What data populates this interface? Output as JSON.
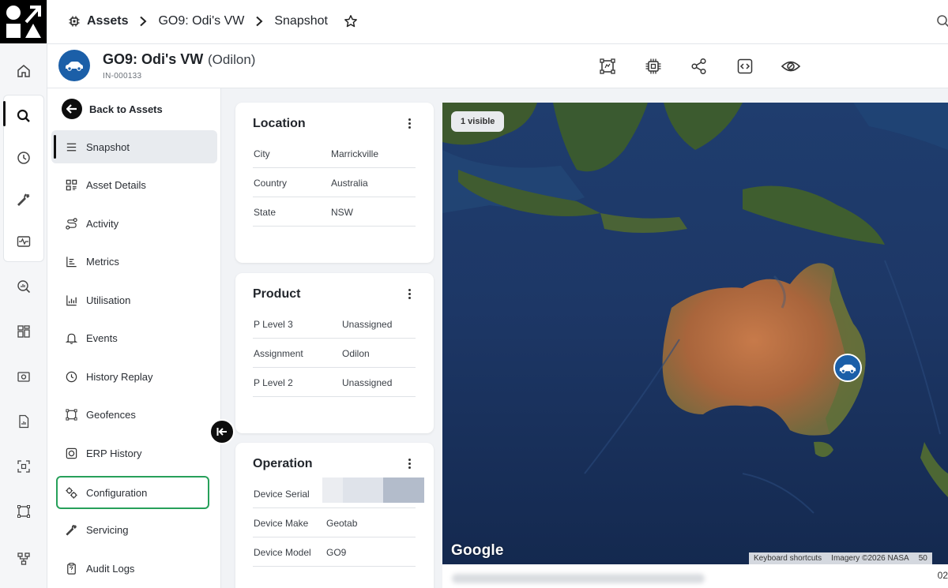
{
  "breadcrumb": {
    "root": "Assets",
    "asset": "GO9: Odi's VW",
    "current": "Snapshot"
  },
  "asset": {
    "name": "GO9: Odi's VW",
    "owner": "(Odilon)",
    "id": "IN-000133"
  },
  "header_actions": [
    "geofence-icon",
    "device-chip-icon",
    "share-icon",
    "embed-code-icon",
    "visibility-icon"
  ],
  "subnav": {
    "back_label": "Back to Assets",
    "items": [
      {
        "label": "Snapshot",
        "icon": "list-icon"
      },
      {
        "label": "Asset Details",
        "icon": "details-grid-icon"
      },
      {
        "label": "Activity",
        "icon": "activity-route-icon"
      },
      {
        "label": "Metrics",
        "icon": "metrics-icon"
      },
      {
        "label": "Utilisation",
        "icon": "utilisation-chart-icon"
      },
      {
        "label": "Events",
        "icon": "bell-icon"
      },
      {
        "label": "History Replay",
        "icon": "clock-icon"
      },
      {
        "label": "Geofences",
        "icon": "geofence-icon"
      },
      {
        "label": "ERP History",
        "icon": "erp-icon"
      },
      {
        "label": "Configuration",
        "icon": "gears-icon"
      },
      {
        "label": "Servicing",
        "icon": "wrench-icon"
      },
      {
        "label": "Audit Logs",
        "icon": "clipboard-icon"
      }
    ]
  },
  "cards": {
    "location": {
      "title": "Location",
      "rows": [
        {
          "key": "City",
          "value": "Marrickville"
        },
        {
          "key": "Country",
          "value": "Australia"
        },
        {
          "key": "State",
          "value": "NSW"
        }
      ]
    },
    "product": {
      "title": "Product",
      "rows": [
        {
          "key": "P Level 3",
          "value": "Unassigned"
        },
        {
          "key": "Assignment",
          "value": "Odilon"
        },
        {
          "key": "P Level 2",
          "value": "Unassigned"
        }
      ]
    },
    "operation": {
      "title": "Operation",
      "rows": [
        {
          "key": "Device Serial",
          "value": ""
        },
        {
          "key": "Device Make",
          "value": "Geotab"
        },
        {
          "key": "Device Model",
          "value": "GO9"
        }
      ]
    }
  },
  "map": {
    "visible_badge": "1 visible",
    "logo": "Google",
    "keyboard_shortcuts": "Keyboard shortcuts",
    "imagery": "Imagery ©2026 NASA",
    "scale_text": "50",
    "footer_number": "02"
  },
  "colors": {
    "accent_blue": "#1b5fa8",
    "highlight_green": "#27a05a",
    "ocean": "#1b3768"
  }
}
